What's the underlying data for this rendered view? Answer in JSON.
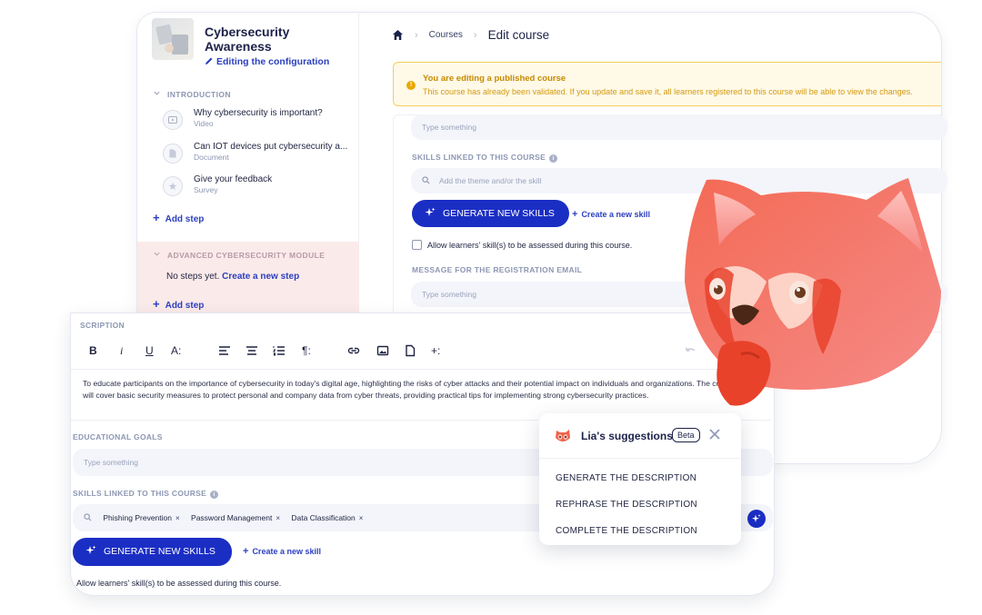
{
  "course": {
    "title": "Cybersecurity Awareness",
    "editing_label": "Editing the configuration"
  },
  "sidebar": {
    "sections": [
      {
        "title": "INTRODUCTION",
        "steps": [
          {
            "title": "Why cybersecurity is important?",
            "type": "Video"
          },
          {
            "title": "Can IOT devices put cybersecurity a...",
            "type": "Document"
          },
          {
            "title": "Give your feedback",
            "type": "Survey"
          }
        ],
        "add_step": "Add step"
      },
      {
        "title": "ADVANCED CYBERSECURITY MODULE",
        "no_steps": "No steps yet.",
        "create_step": "Create a new step",
        "add_step": "Add step"
      }
    ]
  },
  "breadcrumb": {
    "courses": "Courses",
    "current": "Edit course"
  },
  "warning": {
    "title": "You are editing a published course",
    "text": "This course has already been validated. If you update and save it, all learners registered to this course will be able to view the changes."
  },
  "back_form": {
    "top_placeholder": "Type something",
    "skills_label": "SKILLS LINKED TO THIS COURSE",
    "skills_placeholder": "Add the theme and/or the skill",
    "generate_label": "GENERATE NEW SKILLS",
    "create_skill": "Create a new skill",
    "allow_assess": "Allow learners' skill(s) to be assessed during this course.",
    "email_label": "MESSAGE FOR THE REGISTRATION EMAIL",
    "email_placeholder": "Type something"
  },
  "front_form": {
    "description_label": "SCRIPTION",
    "description_text": "To educate participants on the importance of cybersecurity in today's digital age, highlighting the risks of cyber attacks and their potential impact on individuals and organizations. The course will cover basic security measures to protect personal and company data from cyber threats, providing practical tips for implementing strong cybersecurity practices.",
    "goals_label": "EDUCATIONAL GOALS",
    "goals_placeholder": "Type something",
    "skills_label": "SKILLS LINKED TO THIS COURSE",
    "skills": [
      "Phishing Prevention",
      "Password Management",
      "Data Classification"
    ],
    "generate_label": "GENERATE NEW SKILLS",
    "create_skill": "Create a new skill",
    "allow_assess": "Allow learners' skill(s) to be assessed during this course."
  },
  "toolbar": {
    "bold": "B",
    "italic": "i",
    "underline": "U",
    "font_size": "A:",
    "paragraph": "¶:",
    "insert_more": "+:"
  },
  "lia": {
    "title": "Lia's suggestions",
    "badge": "Beta",
    "options": [
      "GENERATE THE DESCRIPTION",
      "REPHRASE THE DESCRIPTION",
      "COMPLETE THE DESCRIPTION"
    ]
  },
  "colors": {
    "primary": "#1b2ec4",
    "link": "#2b3fbf",
    "warning_bg": "#fff9e7",
    "warning_text": "#c78a00",
    "module_bg": "#fbeaea",
    "mascot": "#f0624a"
  }
}
